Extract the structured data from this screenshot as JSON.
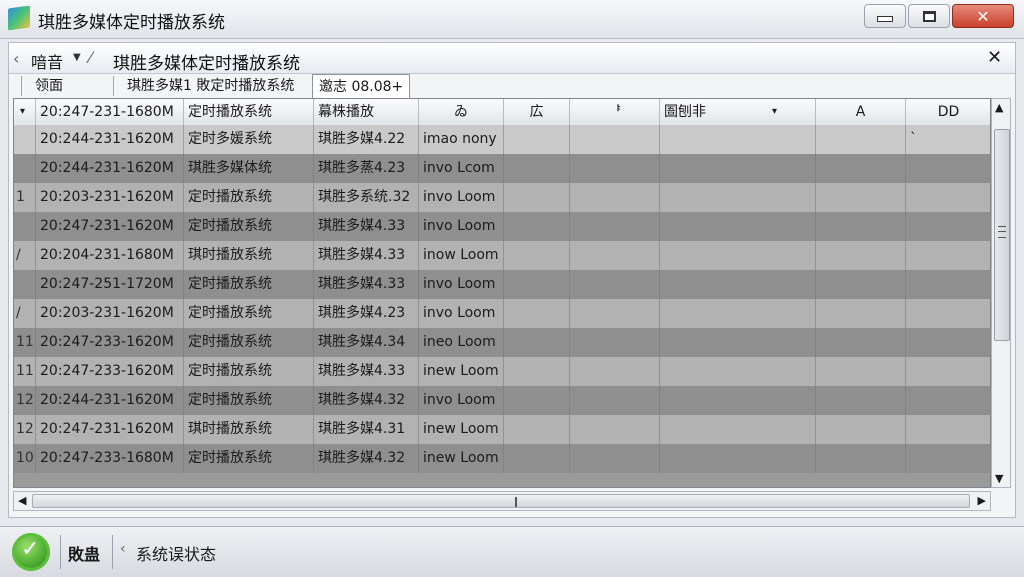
{
  "window": {
    "title": "琪胜多媒体定时播放系统",
    "min_symbol": "",
    "max_symbol": "",
    "close_symbol": "✕"
  },
  "breadcrumb": {
    "back": "‹",
    "root": "喑音",
    "caret": "▼",
    "sep": "⁄",
    "title": "琪胜多媒体定时播放系统",
    "close": "✕"
  },
  "tabs": [
    {
      "label": "领面"
    },
    {
      "label": "琪胜多媒1 敗定时播放系统"
    },
    {
      "label": "邀志 08.08+"
    }
  ],
  "table": {
    "headers": [
      "",
      "20:247-231-1680M",
      "定时播放系统",
      "幕株播放",
      "ゐ",
      "広",
      "ᅣ",
      "圄刨非",
      "A",
      "DD"
    ],
    "rows": [
      [
        "",
        "20:244-231-1620M",
        "定时多媛系统",
        "琪胜多媒4.22",
        "imao nony",
        "",
        "",
        "",
        "",
        "`"
      ],
      [
        "",
        "20:244-231-1620M",
        "琪胜多媒体统",
        "琪胜多蒸4.23",
        "invo Lcom",
        "",
        "",
        "",
        "",
        ""
      ],
      [
        "1",
        "20:203-231-1620M",
        "定时播放系统",
        "琪胜多系统.32",
        "invo Loom",
        "",
        "",
        "",
        "",
        ""
      ],
      [
        "",
        "20:247-231-1620M",
        "定时播放系统",
        "琪胜多媒4.33",
        "invo Loom",
        "",
        "",
        "",
        "",
        ""
      ],
      [
        "/",
        "20:204-231-1680M",
        "琪时播放系统",
        "琪胜多媒4.33",
        "inow Loom",
        "",
        "",
        "",
        "",
        ""
      ],
      [
        "",
        "20:247-251-1720M",
        "定时播放系统",
        "琪胜多媒4.33",
        "invo Loom",
        "",
        "",
        "",
        "",
        ""
      ],
      [
        "/",
        "20:203-231-1620M",
        "定时播放系统",
        "琪胜多媒4.23",
        "invo Loom",
        "",
        "",
        "",
        "",
        ""
      ],
      [
        "11",
        "20:247-233-1620M",
        "定时播放系统",
        "琪胜多媒4.34",
        "ineo Loom",
        "",
        "",
        "",
        "",
        ""
      ],
      [
        "11",
        "20:247-233-1620M",
        "定时播放系统",
        "琪胜多媒4.33",
        "inew Loom",
        "",
        "",
        "",
        "",
        ""
      ],
      [
        "12",
        "20:244-231-1620M",
        "定时播放系统",
        "琪胜多媒4.32",
        "invo Loom",
        "",
        "",
        "",
        "",
        ""
      ],
      [
        "12",
        "20:247-231-1620M",
        "琪时播放系统",
        "琪胜多媒4.31",
        "inew Loom",
        "",
        "",
        "",
        "",
        ""
      ],
      [
        "10",
        "20:247-233-1680M",
        "定时播放系统",
        "琪胜多媒4.32",
        "inew Loom",
        "",
        "",
        "",
        "",
        ""
      ]
    ]
  },
  "scroll": {
    "up": "▲",
    "down": "▼",
    "left": "◀",
    "right": "▶"
  },
  "status": {
    "label": "敗蛊",
    "back": "‹",
    "text": "系统误状态"
  },
  "colors": {
    "row_light": "#b2b2b2",
    "row_dark": "#8f8f8f",
    "status_icon": "#4bab2f",
    "close_button": "#c8412c"
  },
  "icons": {
    "app": "app-icon",
    "status": "check-gear-icon"
  }
}
